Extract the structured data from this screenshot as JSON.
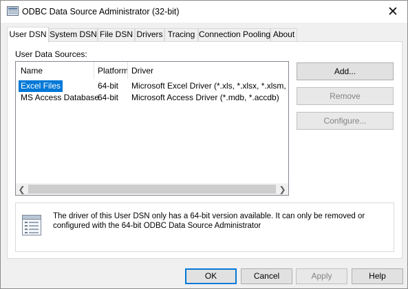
{
  "window": {
    "title": "ODBC Data Source Administrator (32-bit)"
  },
  "tabs": [
    {
      "label": "User DSN"
    },
    {
      "label": "System DSN"
    },
    {
      "label": "File DSN"
    },
    {
      "label": "Drivers"
    },
    {
      "label": "Tracing"
    },
    {
      "label": "Connection Pooling"
    },
    {
      "label": "About"
    }
  ],
  "active_tab": "User DSN",
  "section_label": "User Data Sources:",
  "table": {
    "columns": [
      "Name",
      "Platform",
      "Driver"
    ],
    "rows": [
      {
        "name": "Excel Files",
        "platform": "64-bit",
        "driver": "Microsoft Excel Driver (*.xls, *.xlsx, *.xlsm, *.xlsb)",
        "selected": true
      },
      {
        "name": "MS Access Database",
        "platform": "64-bit",
        "driver": "Microsoft Access Driver (*.mdb, *.accdb)",
        "selected": false
      }
    ]
  },
  "side_buttons": {
    "add": "Add...",
    "remove": "Remove",
    "configure": "Configure..."
  },
  "info_text": "The driver of this User DSN only has a 64-bit version available. It can only be removed or configured with the 64-bit ODBC Data Source Administrator",
  "bottom_buttons": {
    "ok": "OK",
    "cancel": "Cancel",
    "apply": "Apply",
    "help": "Help"
  },
  "colors": {
    "selection": "#0078d7",
    "window_bg": "#f0f0f0"
  },
  "icons": {
    "app": "odbc-datasource-icon",
    "close": "close-icon",
    "info": "document-list-icon"
  }
}
